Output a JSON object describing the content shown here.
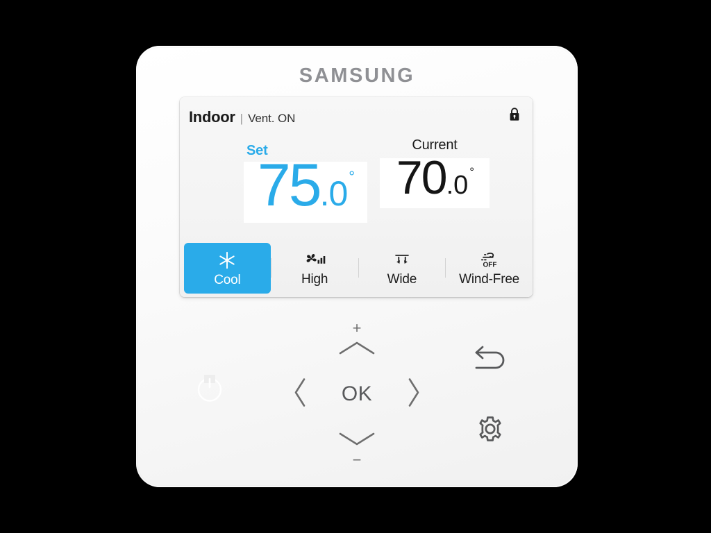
{
  "device": {
    "brand": "SAMSUNG",
    "brand_letters": [
      "S",
      "A",
      "M",
      "S",
      "U",
      "N",
      "G"
    ]
  },
  "colors": {
    "accent_blue": "#2aabe9",
    "screen_bg": "#f4f4f4",
    "body_white": "#fafafa",
    "text_dark": "#1b1b1b",
    "backdrop": "#000000"
  },
  "screen": {
    "header": {
      "zone_label": "Indoor",
      "separator": "|",
      "status": "Vent. ON",
      "lock_icon": "lock-closed-icon"
    },
    "temperature": {
      "set": {
        "label": "Set",
        "integer": "75",
        "decimal": ".0",
        "degree": "°",
        "full": "75.0°",
        "color": "#2aabe9"
      },
      "current": {
        "label": "Current",
        "integer": "70",
        "decimal": ".0",
        "degree": "°",
        "full": "70.0°",
        "color": "#151515"
      }
    },
    "modes": [
      {
        "label": "Cool",
        "icon": "snowflake-icon",
        "active": true
      },
      {
        "label": "High",
        "icon": "fan-speed-icon",
        "active": false
      },
      {
        "label": "Wide",
        "icon": "airflow-wide-icon",
        "active": false
      },
      {
        "label": "Wind-Free",
        "icon": "wind-free-off-icon",
        "badge": "OFF",
        "active": false
      }
    ]
  },
  "controls": {
    "power": {
      "label": "power-button",
      "icon": "power-icon"
    },
    "dpad": {
      "plus": "+",
      "minus": "−",
      "ok": "OK",
      "up_icon": "chevron-up-icon",
      "down_icon": "chevron-down-icon",
      "left_icon": "chevron-left-icon",
      "right_icon": "chevron-right-icon"
    },
    "back": {
      "icon": "back-arrow-icon"
    },
    "settings": {
      "icon": "gear-icon"
    }
  }
}
